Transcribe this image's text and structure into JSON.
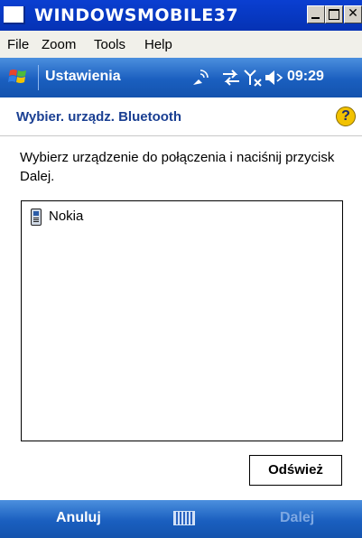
{
  "window": {
    "title": "WINDOWSMOBILE37"
  },
  "menu": [
    "File",
    "Zoom",
    "Tools",
    "Help"
  ],
  "navbar": {
    "title": "Ustawienia",
    "time": "09:29"
  },
  "page": {
    "title": "Wybier. urządz. Bluetooth",
    "help": "?"
  },
  "instructions": "Wybierz urządzenie do połączenia i naciśnij przycisk Dalej.",
  "devices": [
    {
      "label": "Nokia",
      "icon": "phone-icon"
    }
  ],
  "buttons": {
    "refresh": "Odśwież"
  },
  "softkeys": {
    "left": "Anuluj",
    "right": "Dalej"
  },
  "colors": {
    "bar": "#1a5fbf",
    "title_text": "#1a3f92",
    "disabled_softkey": "#7ea8e2"
  }
}
